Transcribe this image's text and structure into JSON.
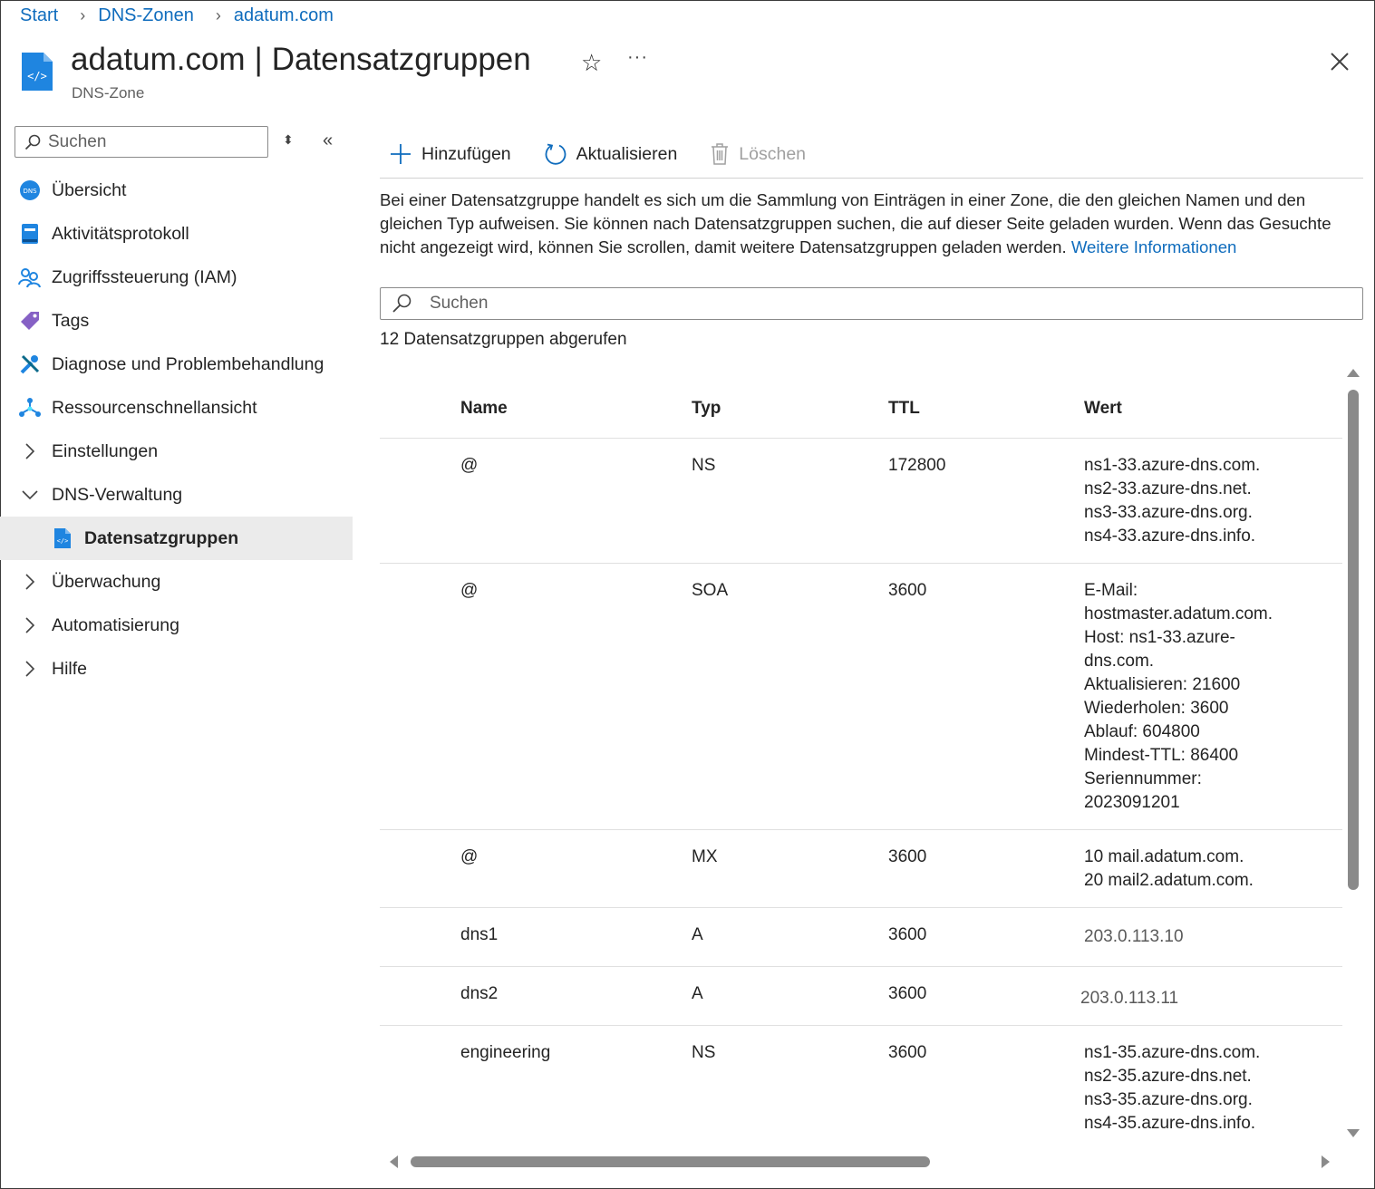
{
  "breadcrumb": {
    "items": [
      "Start",
      "DNS-Zonen",
      "adatum.com"
    ]
  },
  "header": {
    "resource": "adatum.com",
    "separator": "|",
    "page": "Datensatzgruppen",
    "subtitle": "DNS-Zone",
    "more_label": "···"
  },
  "sidebar": {
    "search_placeholder": "Suchen",
    "items": [
      {
        "label": "Übersicht",
        "icon": "dns-icon"
      },
      {
        "label": "Aktivitätsprotokoll",
        "icon": "activity-log-icon"
      },
      {
        "label": "Zugriffssteuerung (IAM)",
        "icon": "iam-icon"
      },
      {
        "label": "Tags",
        "icon": "tag-icon"
      },
      {
        "label": "Diagnose und Problembehandlung",
        "icon": "wrench-icon"
      },
      {
        "label": "Ressourcenschnellansicht",
        "icon": "resource-visualizer-icon"
      },
      {
        "label": "Einstellungen",
        "icon": "chevron-right-icon"
      },
      {
        "label": "DNS-Verwaltung",
        "icon": "chevron-down-icon"
      },
      {
        "label": "Datensatzgruppen",
        "icon": "record-sets-icon",
        "selected": true
      },
      {
        "label": "Überwachung",
        "icon": "chevron-right-icon"
      },
      {
        "label": "Automatisierung",
        "icon": "chevron-right-icon"
      },
      {
        "label": "Hilfe",
        "icon": "chevron-right-icon"
      }
    ]
  },
  "toolbar": {
    "add_label": "Hinzufügen",
    "refresh_label": "Aktualisieren",
    "delete_label": "Löschen"
  },
  "description": {
    "text": "Bei einer Datensatzgruppe handelt es sich um die Sammlung von Einträgen in einer Zone, die den gleichen Namen und den gleichen Typ aufweisen. Sie können nach Datensatzgruppen suchen, die auf dieser Seite geladen wurden. Wenn das Gesuchte nicht angezeigt wird, können Sie scrollen, damit weitere Datensatzgruppen geladen werden.",
    "link": "Weitere Informationen"
  },
  "search": {
    "placeholder": "Suchen"
  },
  "result_count": "12 Datensatzgruppen abgerufen",
  "table": {
    "columns": [
      "Name",
      "Typ",
      "TTL",
      "Wert"
    ],
    "rows": [
      {
        "name": "@",
        "typ": "NS",
        "ttl": "172800",
        "wert": [
          "ns1-33.azure-dns.com.",
          "ns2-33.azure-dns.net.",
          "ns3-33.azure-dns.org.",
          "ns4-33.azure-dns.info."
        ]
      },
      {
        "name": "@",
        "typ": "SOA",
        "ttl": "3600",
        "wert": [
          "E-Mail:",
          "hostmaster.adatum.com.",
          "Host: ns1-33.azure-",
          "dns.com.",
          "Aktualisieren: 21600",
          "Wiederholen: 3600",
          "Ablauf: 604800",
          "Mindest-TTL: 86400",
          "Seriennummer:",
          "2023091201"
        ]
      },
      {
        "name": "@",
        "typ": "MX",
        "ttl": "3600",
        "wert": [
          "10 mail.adatum.com.",
          "20 mail2.adatum.com."
        ]
      },
      {
        "name": "dns1",
        "typ": "A",
        "ttl": "3600",
        "wert": [
          "203.0.113.10"
        ]
      },
      {
        "name": "dns2",
        "typ": "A",
        "ttl": "3600",
        "wert": [
          "203.0.113.11"
        ]
      },
      {
        "name": "engineering",
        "typ": "NS",
        "ttl": "3600",
        "wert": [
          "ns1-35.azure-dns.com.",
          "ns2-35.azure-dns.net.",
          "ns3-35.azure-dns.org.",
          "ns4-35.azure-dns.info."
        ]
      }
    ]
  },
  "colors": {
    "accent": "#0f6cbd",
    "selected_bg": "#ebebeb",
    "text": "#242424"
  }
}
